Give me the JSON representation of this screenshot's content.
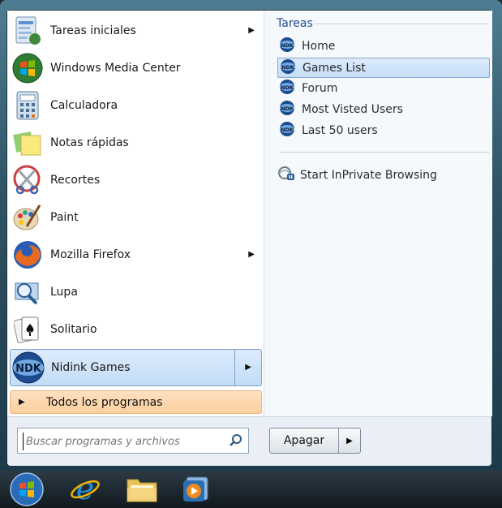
{
  "left_programs": [
    {
      "label": "Tareas iniciales",
      "icon": "getting-started-icon",
      "has_arrow": true
    },
    {
      "label": "Windows Media Center",
      "icon": "media-center-icon",
      "has_arrow": false
    },
    {
      "label": "Calculadora",
      "icon": "calculator-icon",
      "has_arrow": false
    },
    {
      "label": "Notas rápidas",
      "icon": "sticky-notes-icon",
      "has_arrow": false
    },
    {
      "label": "Recortes",
      "icon": "snipping-tool-icon",
      "has_arrow": false
    },
    {
      "label": "Paint",
      "icon": "paint-icon",
      "has_arrow": false
    },
    {
      "label": "Mozilla Firefox",
      "icon": "firefox-icon",
      "has_arrow": true
    },
    {
      "label": "Lupa",
      "icon": "magnifier-icon",
      "has_arrow": false
    },
    {
      "label": "Solitario",
      "icon": "solitaire-icon",
      "has_arrow": false
    },
    {
      "label": "Nidink Games",
      "icon": "ndk-logo-icon",
      "has_arrow": true,
      "selected": true
    }
  ],
  "all_programs_label": "Todos los programas",
  "tasks": {
    "title": "Tareas",
    "items": [
      {
        "label": "Home",
        "icon": "ndk-icon"
      },
      {
        "label": "Games List",
        "icon": "ndk-icon",
        "selected": true
      },
      {
        "label": "Forum",
        "icon": "ndk-icon"
      },
      {
        "label": "Most Visted Users",
        "icon": "ndk-icon"
      },
      {
        "label": "Last 50 users",
        "icon": "ndk-icon"
      }
    ],
    "inprivate": "Start InPrivate Browsing"
  },
  "ndk_text": "NDK",
  "search_placeholder": "Buscar programas y archivos",
  "shutdown_label": "Apagar",
  "taskbar_icons": [
    "start-orb-icon",
    "internet-explorer-icon",
    "explorer-folder-icon",
    "media-player-icon"
  ]
}
